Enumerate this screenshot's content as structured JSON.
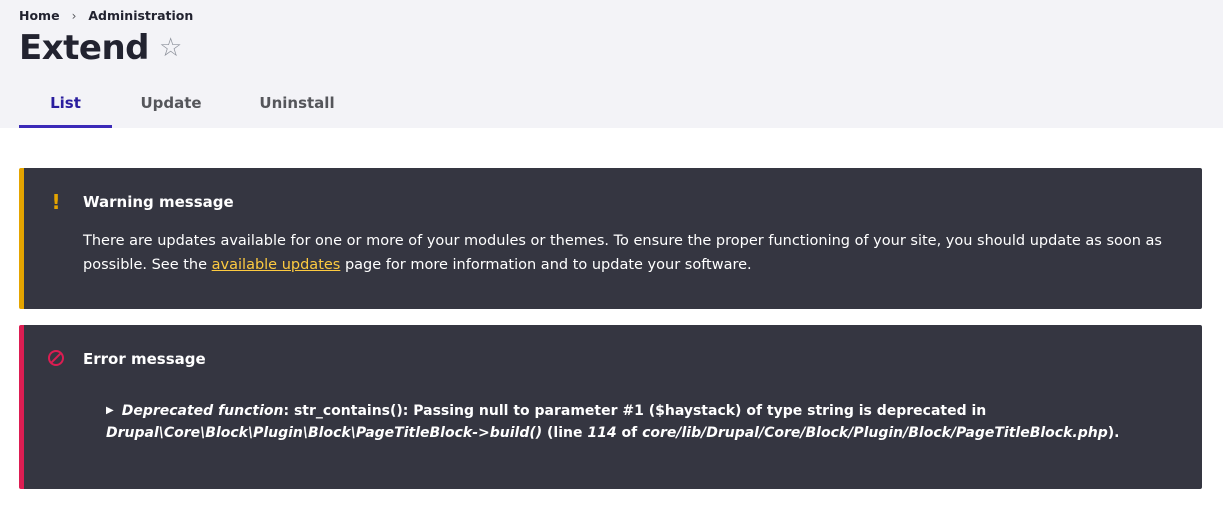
{
  "breadcrumb": {
    "home": "Home",
    "admin": "Administration",
    "separator": "›"
  },
  "page": {
    "title": "Extend",
    "star": "☆"
  },
  "tabs": [
    {
      "label": "List",
      "active": true
    },
    {
      "label": "Update",
      "active": false
    },
    {
      "label": "Uninstall",
      "active": false
    }
  ],
  "warning": {
    "icon": "!",
    "title": "Warning message",
    "text_before": "There are updates available for one or more of your modules or themes. To ensure the proper functioning of your site, you should update as soon as possible. See the ",
    "link": "available updates",
    "text_after": " page for more information and to update your software."
  },
  "error": {
    "title": "Error message",
    "toggle": "▶",
    "label": "Deprecated function",
    "text1": ": str_contains(): Passing null to parameter #1 ($haystack) of type string is deprecated in ",
    "method": "Drupal\\Core\\Block\\Plugin\\Block\\PageTitleBlock->build()",
    "line_prefix": " (line ",
    "line": "114",
    "of": " of ",
    "file": "core/lib/Drupal/Core/Block/Plugin/Block/PageTitleBlock.php",
    "end": ")."
  },
  "colors": {
    "warning": "#e4a400",
    "error": "#dc1d52",
    "tab_active": "#3b2ab8",
    "message_bg": "#353641",
    "link": "#fdca40"
  }
}
